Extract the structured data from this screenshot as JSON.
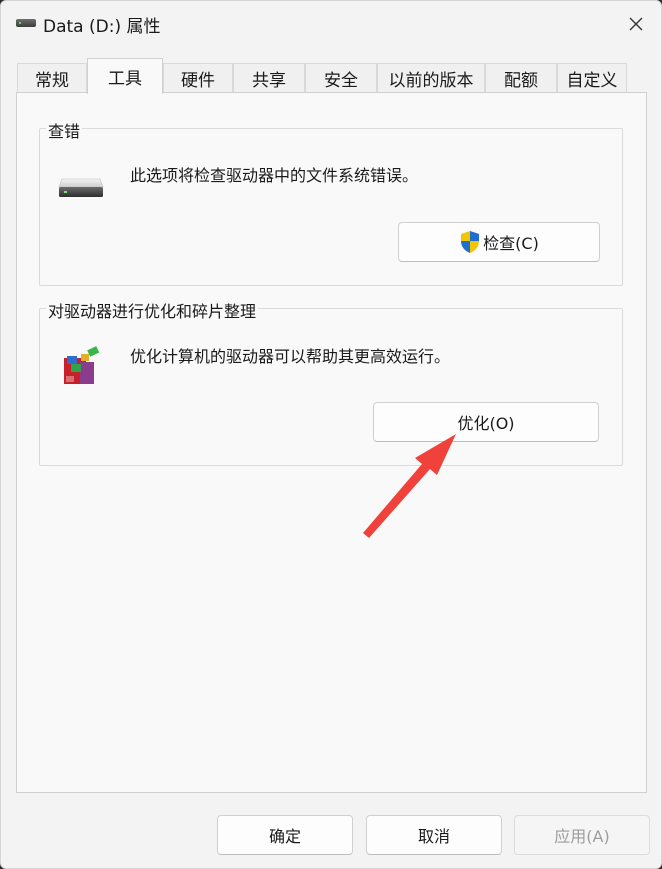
{
  "window": {
    "title": "Data (D:) 属性",
    "icon": "drive-icon",
    "close_icon": "close-icon"
  },
  "tabs": [
    {
      "label": "常规",
      "active": false
    },
    {
      "label": "工具",
      "active": true
    },
    {
      "label": "硬件",
      "active": false
    },
    {
      "label": "共享",
      "active": false
    },
    {
      "label": "安全",
      "active": false
    },
    {
      "label": "以前的版本",
      "active": false
    },
    {
      "label": "配额",
      "active": false
    },
    {
      "label": "自定义",
      "active": false
    }
  ],
  "error_check": {
    "title": "查错",
    "description": "此选项将检查驱动器中的文件系统错误。",
    "button_label": "检查(C)",
    "icon": "hard-drive-icon",
    "button_icon": "uac-shield-icon"
  },
  "optimize": {
    "title": "对驱动器进行优化和碎片整理",
    "description": "优化计算机的驱动器可以帮助其更高效运行。",
    "button_label": "优化(O)",
    "icon": "defrag-icon"
  },
  "annotation": {
    "icon": "red-arrow-annotation",
    "color": "#f0413a"
  },
  "footer": {
    "ok_label": "确定",
    "cancel_label": "取消",
    "apply_label": "应用(A)"
  },
  "colors": {
    "window_bg": "#f3f3f3",
    "panel_bg": "#f9f9f9",
    "shield_blue": "#1f6fd1",
    "shield_yellow": "#f5c400"
  }
}
